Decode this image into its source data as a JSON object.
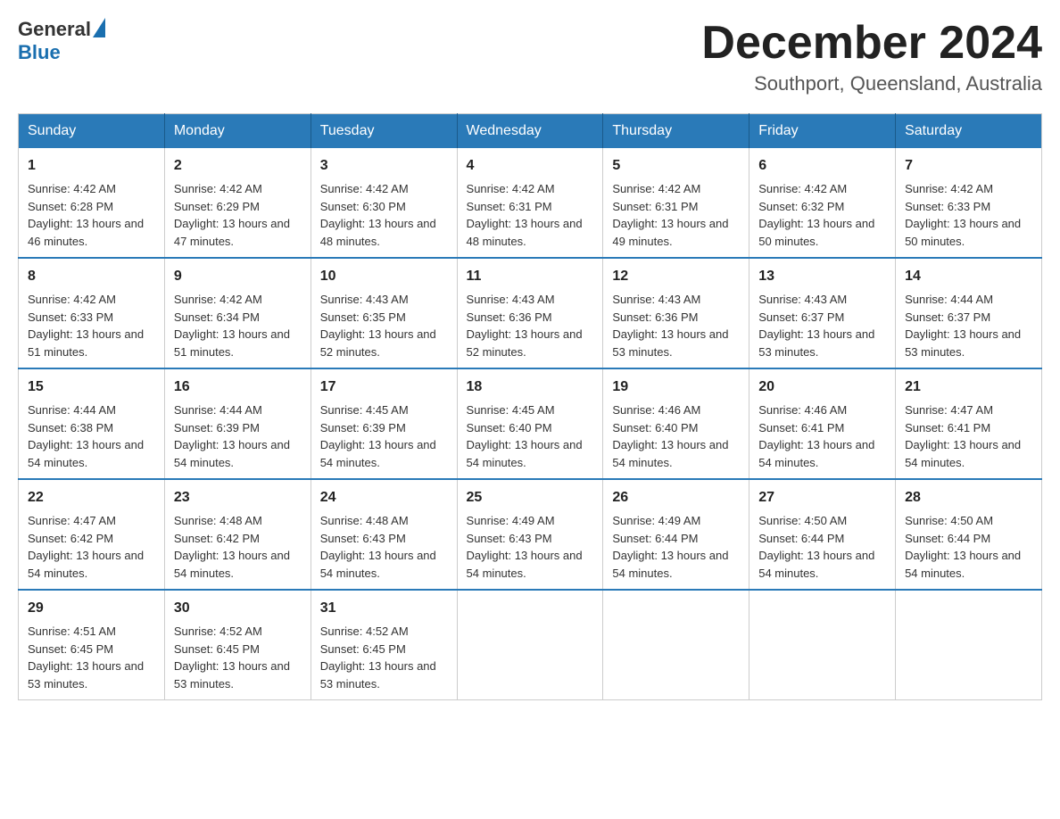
{
  "logo": {
    "text_general": "General",
    "text_blue": "Blue",
    "triangle_char": "▶"
  },
  "title": {
    "month_year": "December 2024",
    "location": "Southport, Queensland, Australia"
  },
  "headers": [
    "Sunday",
    "Monday",
    "Tuesday",
    "Wednesday",
    "Thursday",
    "Friday",
    "Saturday"
  ],
  "weeks": [
    [
      {
        "day": "1",
        "sunrise": "Sunrise: 4:42 AM",
        "sunset": "Sunset: 6:28 PM",
        "daylight": "Daylight: 13 hours and 46 minutes."
      },
      {
        "day": "2",
        "sunrise": "Sunrise: 4:42 AM",
        "sunset": "Sunset: 6:29 PM",
        "daylight": "Daylight: 13 hours and 47 minutes."
      },
      {
        "day": "3",
        "sunrise": "Sunrise: 4:42 AM",
        "sunset": "Sunset: 6:30 PM",
        "daylight": "Daylight: 13 hours and 48 minutes."
      },
      {
        "day": "4",
        "sunrise": "Sunrise: 4:42 AM",
        "sunset": "Sunset: 6:31 PM",
        "daylight": "Daylight: 13 hours and 48 minutes."
      },
      {
        "day": "5",
        "sunrise": "Sunrise: 4:42 AM",
        "sunset": "Sunset: 6:31 PM",
        "daylight": "Daylight: 13 hours and 49 minutes."
      },
      {
        "day": "6",
        "sunrise": "Sunrise: 4:42 AM",
        "sunset": "Sunset: 6:32 PM",
        "daylight": "Daylight: 13 hours and 50 minutes."
      },
      {
        "day": "7",
        "sunrise": "Sunrise: 4:42 AM",
        "sunset": "Sunset: 6:33 PM",
        "daylight": "Daylight: 13 hours and 50 minutes."
      }
    ],
    [
      {
        "day": "8",
        "sunrise": "Sunrise: 4:42 AM",
        "sunset": "Sunset: 6:33 PM",
        "daylight": "Daylight: 13 hours and 51 minutes."
      },
      {
        "day": "9",
        "sunrise": "Sunrise: 4:42 AM",
        "sunset": "Sunset: 6:34 PM",
        "daylight": "Daylight: 13 hours and 51 minutes."
      },
      {
        "day": "10",
        "sunrise": "Sunrise: 4:43 AM",
        "sunset": "Sunset: 6:35 PM",
        "daylight": "Daylight: 13 hours and 52 minutes."
      },
      {
        "day": "11",
        "sunrise": "Sunrise: 4:43 AM",
        "sunset": "Sunset: 6:36 PM",
        "daylight": "Daylight: 13 hours and 52 minutes."
      },
      {
        "day": "12",
        "sunrise": "Sunrise: 4:43 AM",
        "sunset": "Sunset: 6:36 PM",
        "daylight": "Daylight: 13 hours and 53 minutes."
      },
      {
        "day": "13",
        "sunrise": "Sunrise: 4:43 AM",
        "sunset": "Sunset: 6:37 PM",
        "daylight": "Daylight: 13 hours and 53 minutes."
      },
      {
        "day": "14",
        "sunrise": "Sunrise: 4:44 AM",
        "sunset": "Sunset: 6:37 PM",
        "daylight": "Daylight: 13 hours and 53 minutes."
      }
    ],
    [
      {
        "day": "15",
        "sunrise": "Sunrise: 4:44 AM",
        "sunset": "Sunset: 6:38 PM",
        "daylight": "Daylight: 13 hours and 54 minutes."
      },
      {
        "day": "16",
        "sunrise": "Sunrise: 4:44 AM",
        "sunset": "Sunset: 6:39 PM",
        "daylight": "Daylight: 13 hours and 54 minutes."
      },
      {
        "day": "17",
        "sunrise": "Sunrise: 4:45 AM",
        "sunset": "Sunset: 6:39 PM",
        "daylight": "Daylight: 13 hours and 54 minutes."
      },
      {
        "day": "18",
        "sunrise": "Sunrise: 4:45 AM",
        "sunset": "Sunset: 6:40 PM",
        "daylight": "Daylight: 13 hours and 54 minutes."
      },
      {
        "day": "19",
        "sunrise": "Sunrise: 4:46 AM",
        "sunset": "Sunset: 6:40 PM",
        "daylight": "Daylight: 13 hours and 54 minutes."
      },
      {
        "day": "20",
        "sunrise": "Sunrise: 4:46 AM",
        "sunset": "Sunset: 6:41 PM",
        "daylight": "Daylight: 13 hours and 54 minutes."
      },
      {
        "day": "21",
        "sunrise": "Sunrise: 4:47 AM",
        "sunset": "Sunset: 6:41 PM",
        "daylight": "Daylight: 13 hours and 54 minutes."
      }
    ],
    [
      {
        "day": "22",
        "sunrise": "Sunrise: 4:47 AM",
        "sunset": "Sunset: 6:42 PM",
        "daylight": "Daylight: 13 hours and 54 minutes."
      },
      {
        "day": "23",
        "sunrise": "Sunrise: 4:48 AM",
        "sunset": "Sunset: 6:42 PM",
        "daylight": "Daylight: 13 hours and 54 minutes."
      },
      {
        "day": "24",
        "sunrise": "Sunrise: 4:48 AM",
        "sunset": "Sunset: 6:43 PM",
        "daylight": "Daylight: 13 hours and 54 minutes."
      },
      {
        "day": "25",
        "sunrise": "Sunrise: 4:49 AM",
        "sunset": "Sunset: 6:43 PM",
        "daylight": "Daylight: 13 hours and 54 minutes."
      },
      {
        "day": "26",
        "sunrise": "Sunrise: 4:49 AM",
        "sunset": "Sunset: 6:44 PM",
        "daylight": "Daylight: 13 hours and 54 minutes."
      },
      {
        "day": "27",
        "sunrise": "Sunrise: 4:50 AM",
        "sunset": "Sunset: 6:44 PM",
        "daylight": "Daylight: 13 hours and 54 minutes."
      },
      {
        "day": "28",
        "sunrise": "Sunrise: 4:50 AM",
        "sunset": "Sunset: 6:44 PM",
        "daylight": "Daylight: 13 hours and 54 minutes."
      }
    ],
    [
      {
        "day": "29",
        "sunrise": "Sunrise: 4:51 AM",
        "sunset": "Sunset: 6:45 PM",
        "daylight": "Daylight: 13 hours and 53 minutes."
      },
      {
        "day": "30",
        "sunrise": "Sunrise: 4:52 AM",
        "sunset": "Sunset: 6:45 PM",
        "daylight": "Daylight: 13 hours and 53 minutes."
      },
      {
        "day": "31",
        "sunrise": "Sunrise: 4:52 AM",
        "sunset": "Sunset: 6:45 PM",
        "daylight": "Daylight: 13 hours and 53 minutes."
      },
      null,
      null,
      null,
      null
    ]
  ]
}
